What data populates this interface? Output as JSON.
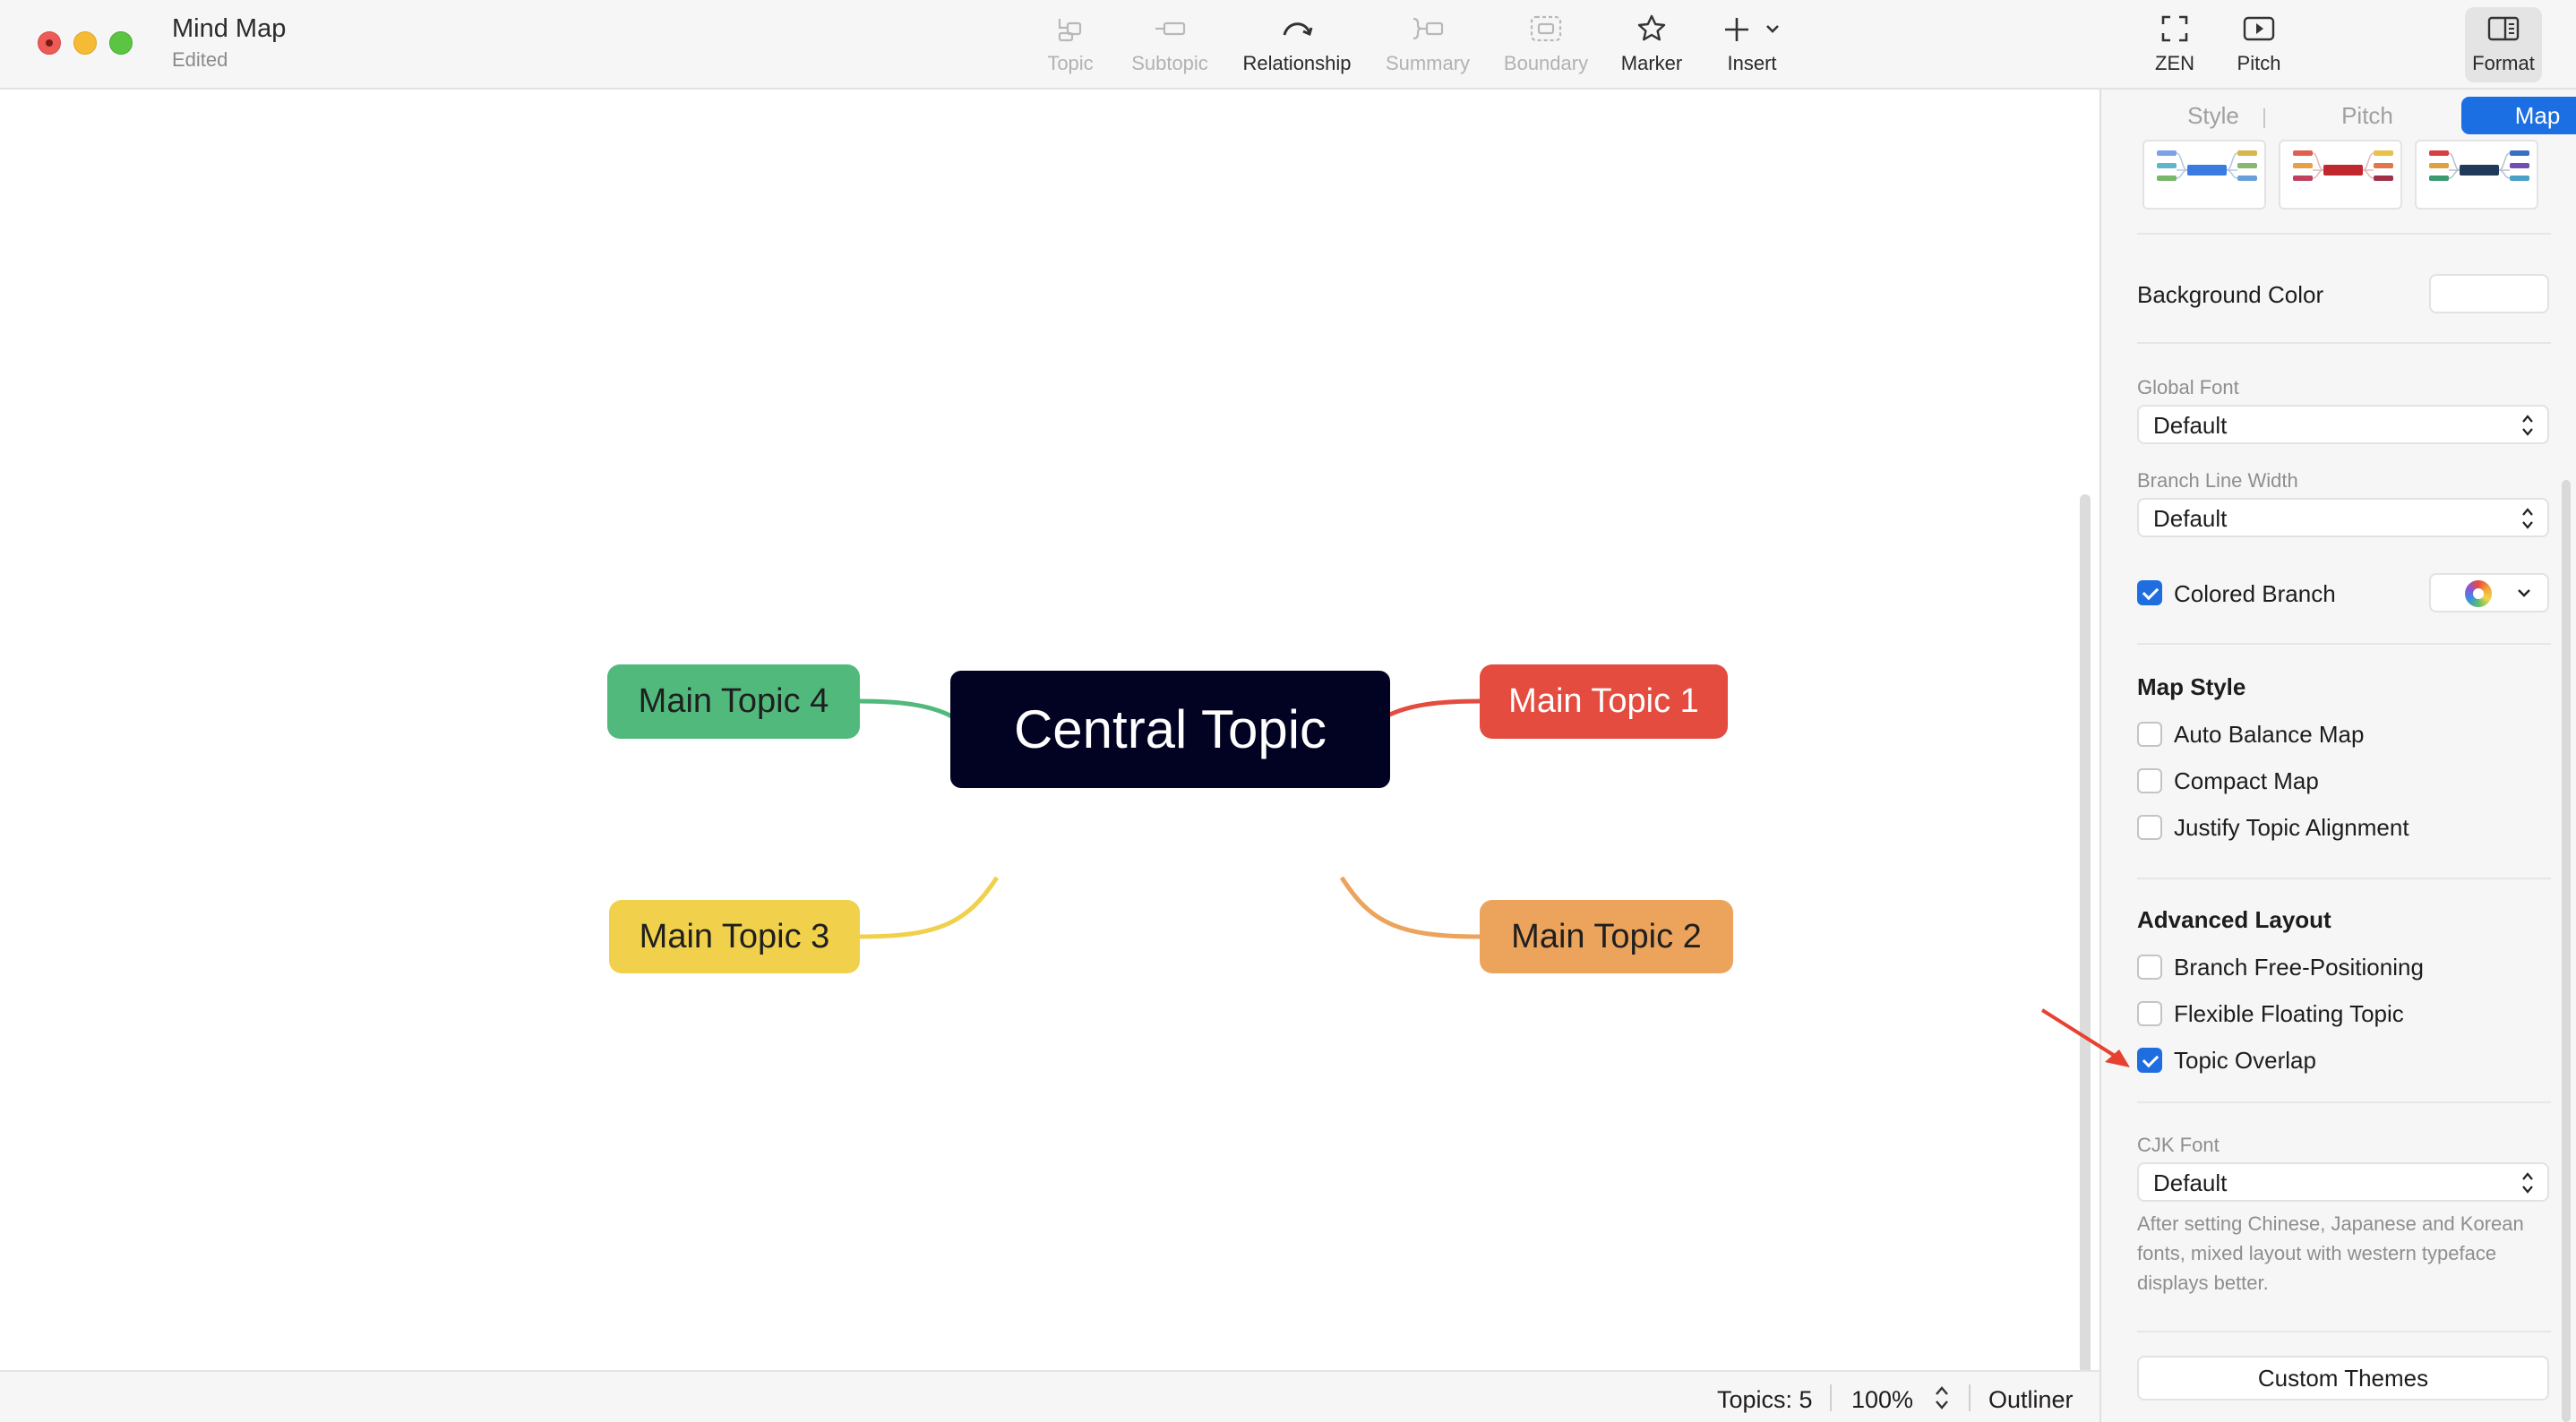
{
  "window": {
    "title": "Mind Map",
    "status": "Edited"
  },
  "toolbar": {
    "tools": {
      "topic": "Topic",
      "subtopic": "Subtopic",
      "relationship": "Relationship",
      "summary": "Summary",
      "boundary": "Boundary",
      "marker": "Marker",
      "insert": "Insert",
      "zen": "ZEN",
      "pitch": "Pitch",
      "format": "Format"
    }
  },
  "map": {
    "central": "Central Topic",
    "topics": [
      "Main Topic 1",
      "Main Topic 2",
      "Main Topic 3",
      "Main Topic 4"
    ],
    "colors": {
      "central": "#020223",
      "topic1": "#e44c40",
      "topic2": "#eca35c",
      "topic3": "#f1d04b",
      "topic4": "#52b97c"
    }
  },
  "statusbar": {
    "topics": "Topics: 5",
    "zoom": "100%",
    "outliner": "Outliner"
  },
  "panel": {
    "tabs": {
      "style": "Style",
      "pitch": "Pitch",
      "map": "Map"
    },
    "selected_tab": "Map",
    "background_color_label": "Background Color",
    "global_font_label": "Global Font",
    "global_font_value": "Default",
    "branch_line_width_label": "Branch Line Width",
    "branch_line_width_value": "Default",
    "colored_branch_label": "Colored Branch",
    "colored_branch_checked": true,
    "map_style_heading": "Map Style",
    "map_style": [
      {
        "label": "Auto Balance Map",
        "checked": false
      },
      {
        "label": "Compact Map",
        "checked": false
      },
      {
        "label": "Justify Topic Alignment",
        "checked": false
      }
    ],
    "advanced_layout_heading": "Advanced Layout",
    "advanced_layout": [
      {
        "label": "Branch Free-Positioning",
        "checked": false
      },
      {
        "label": "Flexible Floating Topic",
        "checked": false
      },
      {
        "label": "Topic Overlap",
        "checked": true
      }
    ],
    "cjk_font_label": "CJK Font",
    "cjk_font_value": "Default",
    "cjk_note": "After setting Chinese, Japanese and Korean fonts, mixed layout with western typeface displays better.",
    "custom_themes": "Custom Themes",
    "accent_color": "#1c6fe3"
  },
  "annotation": {
    "arrow_color": "#e8412f"
  }
}
